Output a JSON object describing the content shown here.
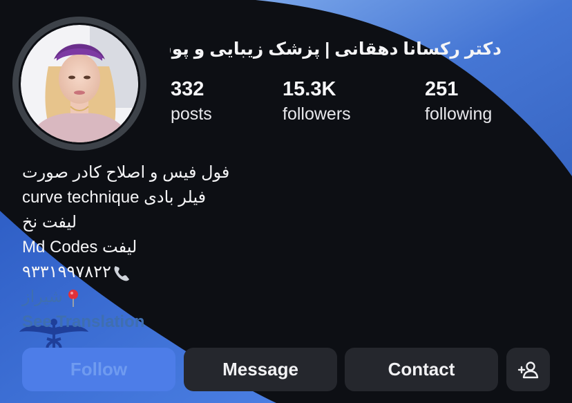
{
  "profile": {
    "name": "دکتر رکسانا دهقانی | پزشک زیبایی و پوست",
    "avatar": "profile-photo"
  },
  "stats": {
    "posts_count": "332",
    "posts_label": "posts",
    "followers_count": "15.3K",
    "followers_label": "followers",
    "following_count": "251",
    "following_label": "following"
  },
  "bio": {
    "line1": "فول فیس و اصلاح کادر صورت",
    "line2": "فیلر بادی curve technique",
    "line3": "لیفت نخ",
    "line4": "لیفت Md Codes",
    "phone": "۹۳۳۱۹۹۷۸۲۲",
    "phone_icon": "telephone-receiver-icon",
    "location": "شیراز",
    "location_icon": "round-pushpin-icon",
    "see_translation": "See Translation"
  },
  "actions": {
    "follow": "Follow",
    "message": "Message",
    "contact": "Contact",
    "add_user_icon": "add-user-icon"
  },
  "colors": {
    "background": "#0d0f14",
    "button_bg": "#25272d",
    "follow_blue": "#4d7de8",
    "link_blue": "#3f6fb0",
    "wave_blue": "#3b72d9"
  }
}
